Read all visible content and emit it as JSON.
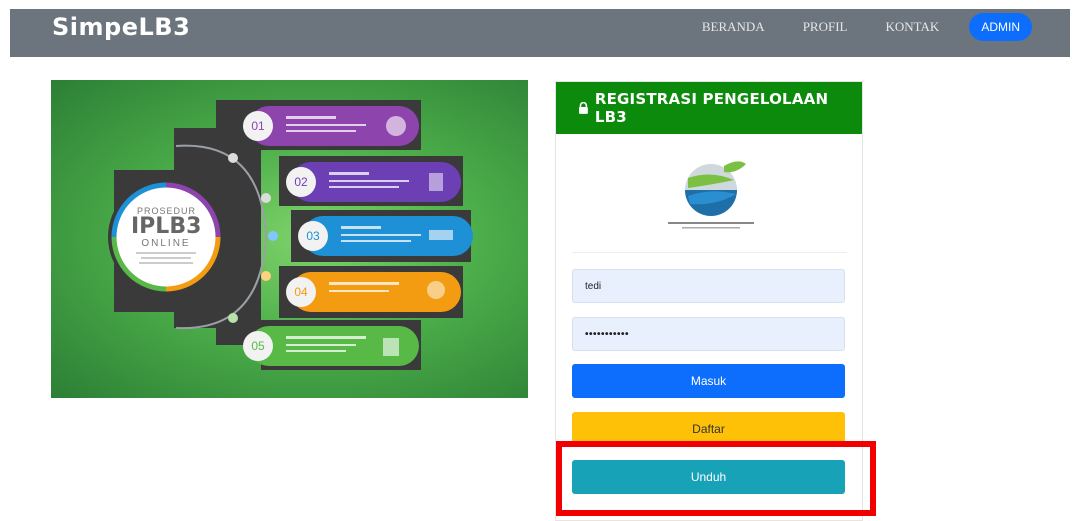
{
  "navbar": {
    "brand": "SimpeLB3",
    "links": [
      "BERANDA",
      "PROFIL",
      "KONTAK"
    ],
    "admin_label": "ADMIN"
  },
  "hero": {
    "circle_line1": "PROSEDUR",
    "circle_line2": "IPLB3",
    "circle_line3": "ONLINE",
    "steps": [
      "01",
      "02",
      "03",
      "04",
      "05"
    ]
  },
  "card": {
    "header_title": "REGISTRASI PENGELOLAAN LB3",
    "username_value": "tedi",
    "password_value": "•••••••••••",
    "masuk_label": "Masuk",
    "daftar_label": "Daftar",
    "unduh_label": "Unduh"
  },
  "colors": {
    "navbar": "#6c757d",
    "header_green": "#0b8a0b",
    "primary": "#0d6efd",
    "warning": "#ffc107",
    "info": "#17a2b8",
    "highlight": "#f20000"
  }
}
